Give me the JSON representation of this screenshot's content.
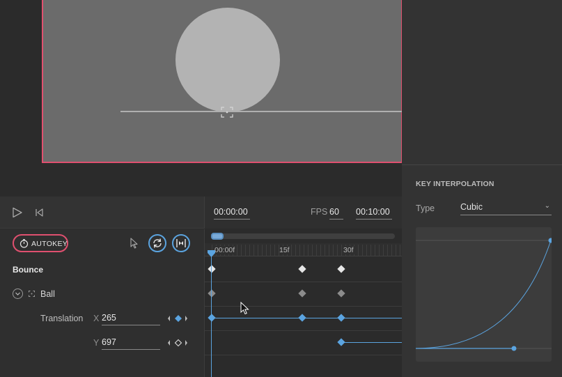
{
  "stage": {
    "accent_color": "#e0506f",
    "ball_color": "#b3b3b3",
    "background_color": "#6b6b6b"
  },
  "interpolation_panel": {
    "title": "KEY INTERPOLATION",
    "type_label": "Type",
    "type_value": "Cubic",
    "curve_color": "#5ba4e0"
  },
  "transport": {
    "play_icon": "play-icon",
    "rewind_icon": "skip-to-start-icon"
  },
  "toolbar": {
    "autokey_label": "AUTOKEY",
    "autokey_icon": "stopwatch-icon",
    "select_icon": "cursor-icon",
    "loop_icon": "loop-icon",
    "fit_icon": "fit-width-icon"
  },
  "timing": {
    "current_time": "00:00:00",
    "fps_label": "FPS",
    "fps_value": "60",
    "duration": "00:10:00"
  },
  "ruler": {
    "ticks": [
      "00:00f",
      "15f",
      "30f"
    ]
  },
  "layers": {
    "group_name": "Bounce",
    "object_name": "Ball",
    "property_name": "Translation",
    "x_label": "X",
    "x_value": "265",
    "y_label": "Y",
    "y_value": "697"
  },
  "colors": {
    "key_selected": "#5ba4e0",
    "key_group": "#e6e6e6",
    "key_object": "#8c8c8c"
  }
}
